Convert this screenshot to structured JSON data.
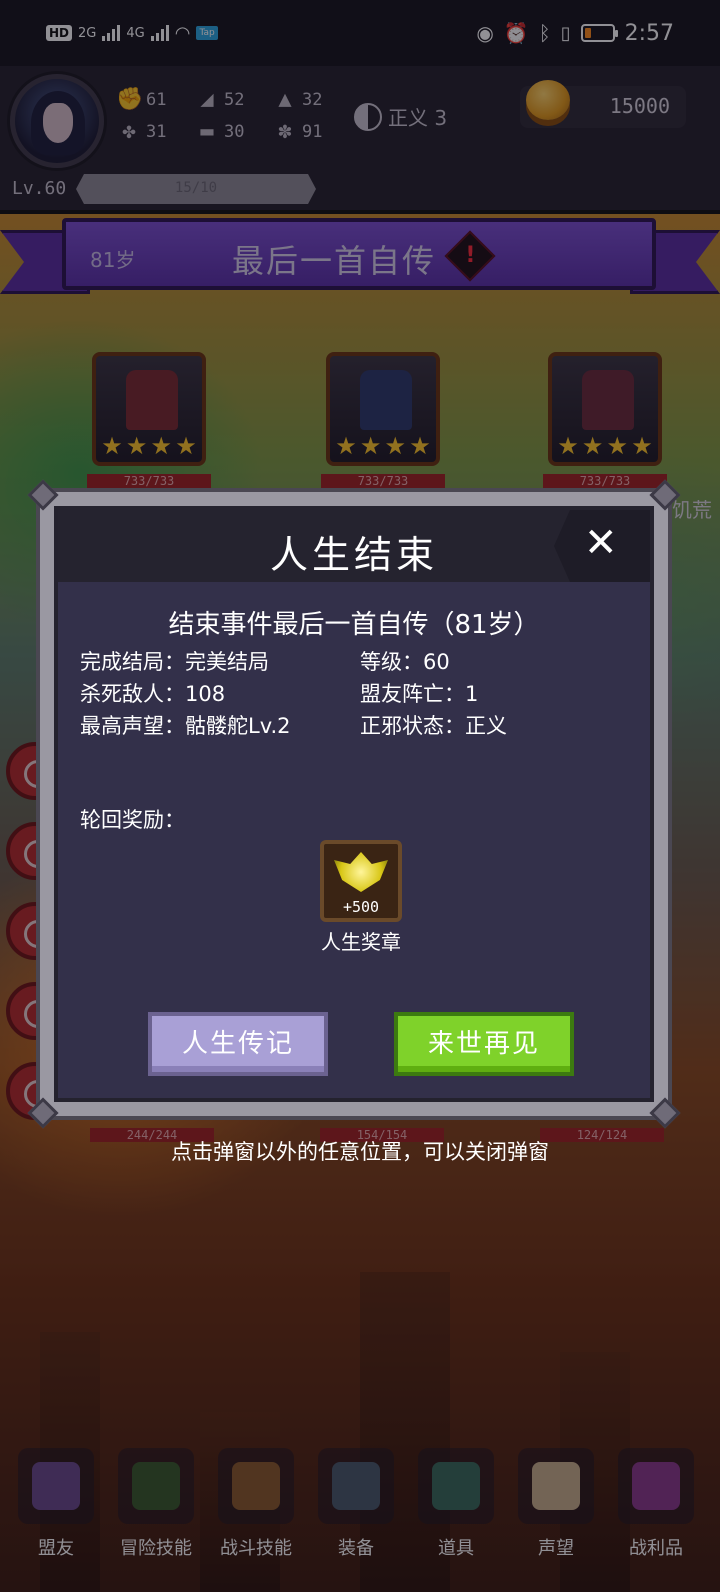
{
  "status_bar": {
    "network_badge": "HD",
    "network_2g": "2G",
    "network_4g": "4G",
    "app_badge": "Tap",
    "time": "2:57",
    "battery_color": "#ff8a1a"
  },
  "hud": {
    "stats": [
      {
        "icon": "fist-icon",
        "value": "61"
      },
      {
        "icon": "boot-icon",
        "value": "52"
      },
      {
        "icon": "wizard-hat-icon",
        "value": "32"
      },
      {
        "icon": "clover-icon",
        "value": "31"
      },
      {
        "icon": "book-icon",
        "value": "30"
      },
      {
        "icon": "sprout-icon",
        "value": "91"
      }
    ],
    "morality_label": "正义 3",
    "coins": "15000",
    "level": "Lv.60",
    "xp_text": "15/10"
  },
  "banner": {
    "age": "81岁",
    "title": "最后一首自传",
    "alert": "!"
  },
  "enemies": [
    {
      "hp": "733/733"
    },
    {
      "hp": "733/733"
    },
    {
      "hp": "733/733"
    }
  ],
  "offscreen_text": "饥荒",
  "dialog": {
    "title": "人生结束",
    "close": "✕",
    "summary": "结束事件最后一首自传（81岁）",
    "fields": {
      "ending": "完成结局：完美结局",
      "level": "等级：60",
      "kills": "杀死敌人：108",
      "ally_deaths": "盟友阵亡：1",
      "reputation": "最高声望：骷髅舵Lv.2",
      "alignment": "正邪状态：正义"
    },
    "reward_label": "轮回奖励：",
    "reward": {
      "amount": "+500",
      "name": "人生奖章"
    },
    "buttons": {
      "legend": "人生传记",
      "again": "来世再见"
    }
  },
  "under_labels": [
    "244/244",
    "154/154",
    "124/124"
  ],
  "close_hint": "点击弹窗以外的任意位置，可以关闭弹窗",
  "bottom_nav": [
    {
      "label": "盟友",
      "icon": "handshake-icon",
      "color": "#6a4a8a"
    },
    {
      "label": "冒险技能",
      "icon": "spellbook-icon",
      "color": "#3a5a2a"
    },
    {
      "label": "战斗技能",
      "icon": "backpack-icon",
      "color": "#8a5a2a"
    },
    {
      "label": "装备",
      "icon": "crossed-swords-icon",
      "color": "#4a5a6a"
    },
    {
      "label": "道具",
      "icon": "satchel-icon",
      "color": "#3a6a5a"
    },
    {
      "label": "声望",
      "icon": "scroll-icon",
      "color": "#c9b08a"
    },
    {
      "label": "战利品",
      "icon": "treasure-chest-icon",
      "color": "#8a3a8a"
    }
  ]
}
